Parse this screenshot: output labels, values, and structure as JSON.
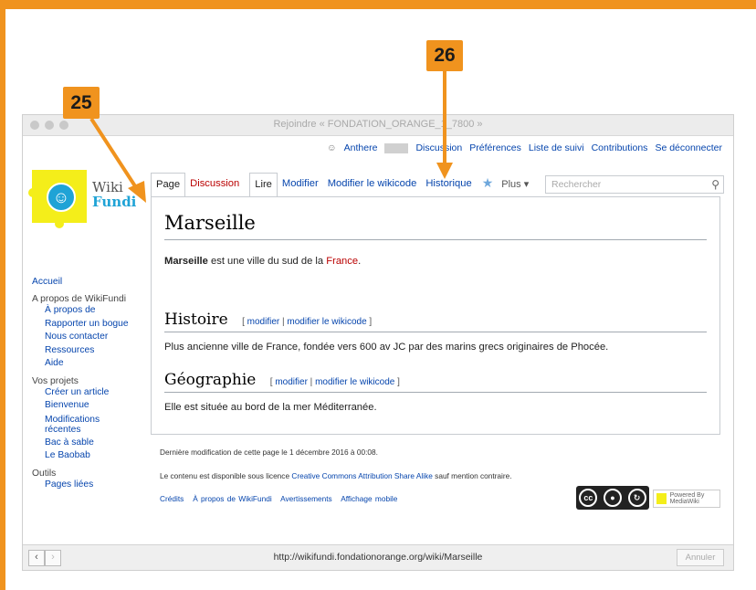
{
  "callouts": {
    "left": "25",
    "right": "26"
  },
  "window": {
    "title": "Rejoindre « FONDATION_ORANGE_1_7800 »"
  },
  "personal": {
    "user": "Anthere",
    "discussion": "Discussion",
    "preferences": "Préférences",
    "watchlist": "Liste de suivi",
    "contributions": "Contributions",
    "logout": "Se déconnecter"
  },
  "logo": {
    "wiki": "Wiki",
    "fundi": "Fundi",
    "glyph": "☺"
  },
  "tabs": {
    "page": "Page",
    "discussion": "Discussion",
    "read": "Lire",
    "edit": "Modifier",
    "edit_source": "Modifier le wikicode",
    "history": "Historique",
    "star_icon": "star-icon",
    "more": "Plus ▾"
  },
  "search": {
    "placeholder": "Rechercher",
    "icon": "⚲"
  },
  "article": {
    "title": "Marseille",
    "intro_bold": "Marseille",
    "intro_rest": " est une ville du sud de la ",
    "intro_link": "France",
    "intro_end": ".",
    "sections": [
      {
        "heading": "Histoire",
        "edit_open": "[ ",
        "edit1": "modifier",
        "edit_sep": " | ",
        "edit2": "modifier le wikicode",
        "edit_close": " ]",
        "text": "Plus ancienne ville de France, fondée vers 600 av JC par des marins grecs originaires de Phocée."
      },
      {
        "heading": "Géographie",
        "edit_open": "[ ",
        "edit1": "modifier",
        "edit_sep": " | ",
        "edit2": "modifier le wikicode",
        "edit_close": " ]",
        "text": "Elle est située au bord de la mer Méditerranée."
      }
    ]
  },
  "sidebar": {
    "home": "Accueil",
    "about_head": "A propos de WikiFundi",
    "about_items": [
      "À propos de",
      "Rapporter un bogue",
      "Nous contacter",
      "Ressources",
      "Aide"
    ],
    "projects_head": "Vos projets",
    "projects_items": [
      "Créer un article",
      "Bienvenue",
      "Modifications récentes",
      "Bac à sable",
      "Le Baobab"
    ],
    "tools_head": "Outils",
    "tools_items": [
      "Pages liées"
    ]
  },
  "footer": {
    "last_modified": "Dernière modification de cette page le 1 décembre 2016 à 00:08.",
    "license_pre": "Le contenu est disponible sous licence ",
    "license_link": "Creative Commons Attribution Share Alike",
    "license_post": " sauf mention contraire.",
    "links": [
      "Crédits",
      "À propos de WikiFundi",
      "Avertissements",
      "Affichage mobile"
    ],
    "cc_label": "cc",
    "mediawiki": "Powered By MediaWiki"
  },
  "statusbar": {
    "url": "http://wikifundi.fondationorange.org/wiki/Marseille",
    "cancel": "Annuler",
    "back": "‹",
    "forward": "›"
  }
}
